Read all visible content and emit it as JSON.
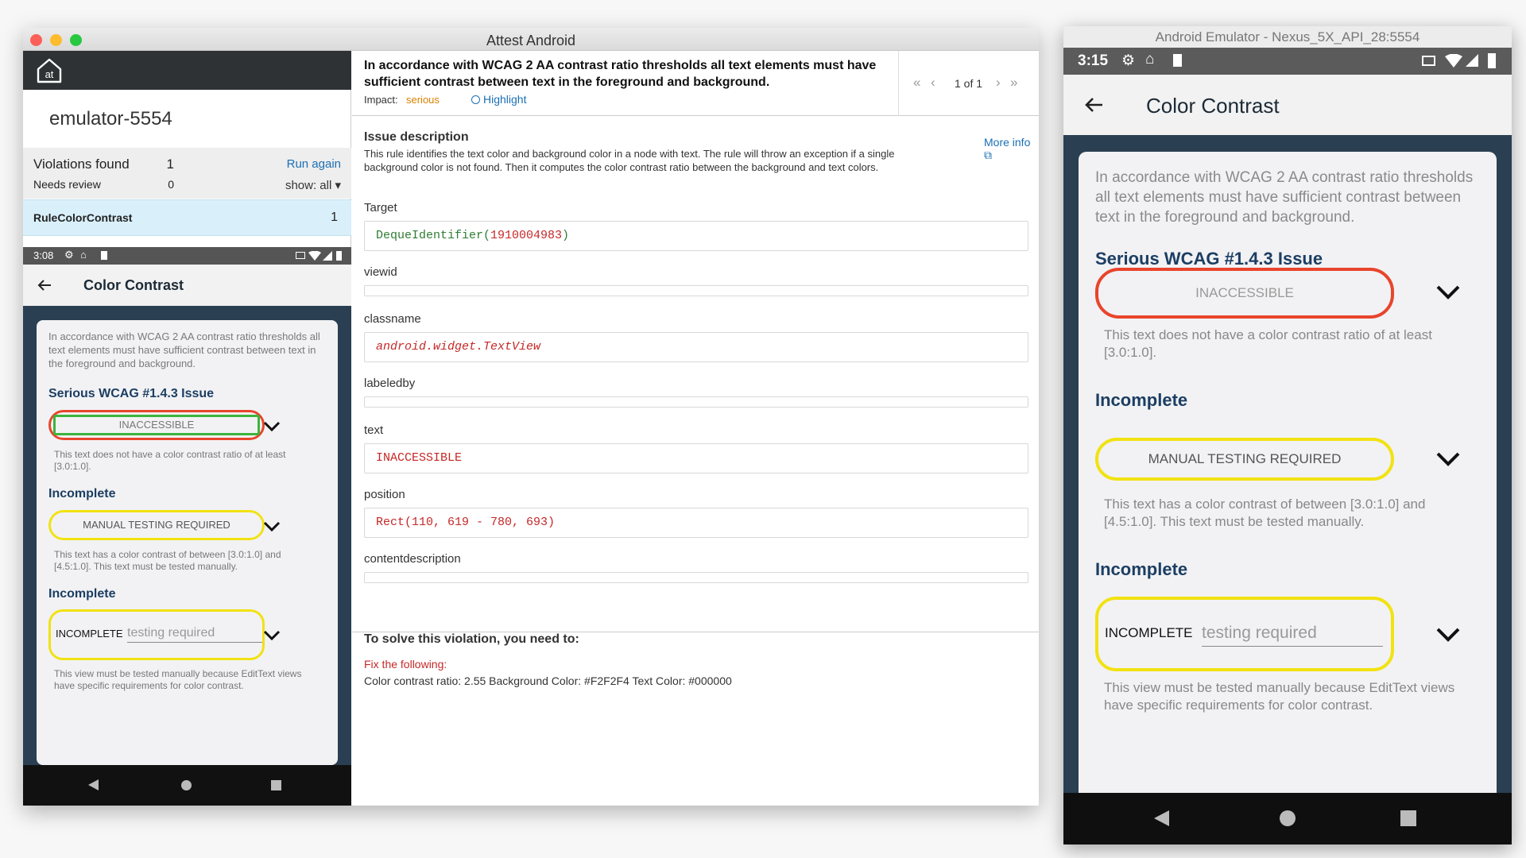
{
  "attest": {
    "window_title": "Attest Android",
    "device_name": "emulator-5554",
    "summary": {
      "violations_label": "Violations found",
      "violations_count": "1",
      "needs_review_label": "Needs review",
      "needs_review_count": "0",
      "run_again": "Run again",
      "show_filter": "show: all ▾"
    },
    "rules": [
      {
        "name": "RuleColorContrast",
        "count": "1"
      }
    ],
    "mini_emulator": {
      "status_time": "3:08",
      "app_title": "Color Contrast",
      "intro": "In accordance with WCAG 2 AA contrast ratio thresholds all text elements must have sufficient contrast between text in the foreground and background.",
      "heading_serious": "Serious WCAG #1.4.3 Issue",
      "pill_inaccessible": "INACCESSIBLE",
      "desc_inaccessible": "This text does not have a color contrast ratio of at least [3.0:1.0].",
      "heading_incomplete1": "Incomplete",
      "pill_manual": "MANUAL TESTING REQUIRED",
      "desc_manual": "This text has a color contrast of between [3.0:1.0] and [4.5:1.0]. This text must be tested manually.",
      "heading_incomplete2": "Incomplete",
      "incomplete_label": "INCOMPLETE",
      "incomplete_placeholder": "testing required",
      "desc_incomplete": "This view must be tested manually because EditText views have specific requirements for color contrast."
    },
    "issue": {
      "title": "In accordance with WCAG 2 AA contrast ratio thresholds all text elements must have sufficient contrast between text in the foreground and background.",
      "impact_label": "Impact:",
      "impact_value": "serious",
      "highlight": "Highlight",
      "pager": "1 of 1",
      "description_heading": "Issue description",
      "description": "This rule identifies the text color and background color in a node with text. The rule will throw an exception if a single background color is not found. Then it computes the color contrast ratio between the background and text colors.",
      "more_info": "More info",
      "fields": [
        {
          "label": "Target",
          "value_fn": "DequeIdentifier(",
          "value_arg": "1910004983",
          "value_end": ")"
        },
        {
          "label": "viewid",
          "value": ""
        },
        {
          "label": "classname",
          "value": "android.widget.TextView"
        },
        {
          "label": "labeledby",
          "value": ""
        },
        {
          "label": "text",
          "value": "INACCESSIBLE"
        },
        {
          "label": "position",
          "value": "Rect(110, 619 - 780, 693)"
        },
        {
          "label": "contentdescription",
          "value": ""
        }
      ],
      "solve_heading": "To solve this violation, you need to:",
      "fix_label": "Fix the following:",
      "fix_detail": "Color contrast ratio: 2.55 Background Color: #F2F2F4 Text Color: #000000"
    }
  },
  "emulator": {
    "window_title": "Android Emulator - Nexus_5X_API_28:5554",
    "status_time": "3:15",
    "app_title": "Color Contrast",
    "intro": "In accordance with WCAG 2 AA contrast ratio thresholds all text elements must have sufficient contrast between text in the foreground and background.",
    "heading_serious": "Serious WCAG #1.4.3 Issue",
    "pill_inaccessible": "INACCESSIBLE",
    "desc_inaccessible": "This text does not have a color contrast ratio of at least [3.0:1.0].",
    "heading_incomplete1": "Incomplete",
    "pill_manual": "MANUAL TESTING REQUIRED",
    "desc_manual": "This text has a color contrast of between [3.0:1.0] and [4.5:1.0]. This text must be tested manually.",
    "heading_incomplete2": "Incomplete",
    "incomplete_label": "INCOMPLETE",
    "incomplete_placeholder": "testing required",
    "desc_incomplete": "This view must be tested manually because EditText views have specific requirements for color contrast."
  },
  "colors": {
    "accent_blue": "#1a6fb5",
    "impact_orange": "#d98200",
    "error_red": "#c62828",
    "serious_pill": "#e8452c",
    "inspect_green": "#3cb43c",
    "incomplete_pill": "#f1e212",
    "heading_navy": "#1c3e63",
    "app_dark": "#2a3f52",
    "target_green": "#2e7d32"
  }
}
